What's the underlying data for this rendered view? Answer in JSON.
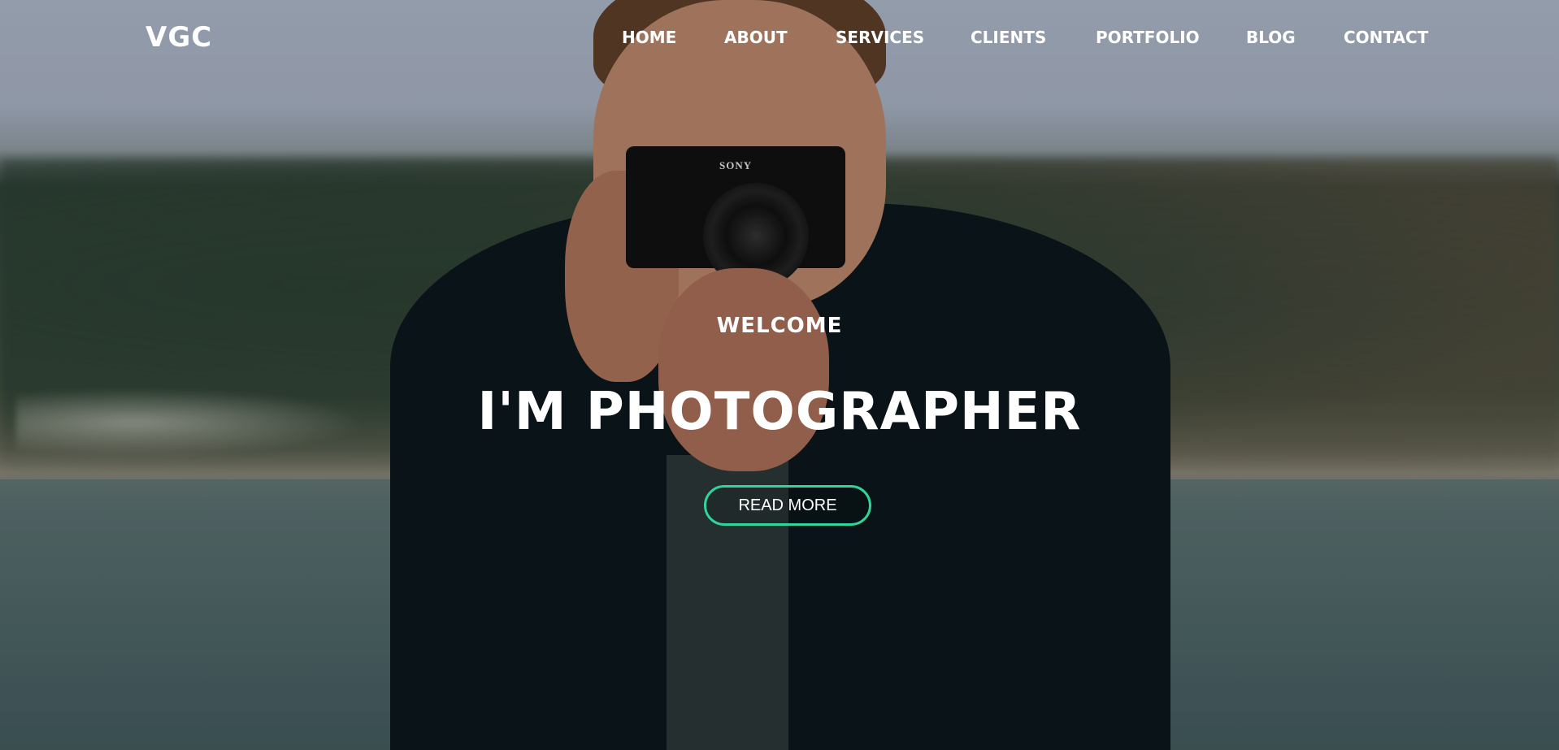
{
  "site": {
    "logo": "VGC"
  },
  "nav": {
    "items": [
      {
        "label": "HOME"
      },
      {
        "label": "ABOUT"
      },
      {
        "label": "SERVICES"
      },
      {
        "label": "CLIENTS"
      },
      {
        "label": "PORTFOLIO"
      },
      {
        "label": "BLOG"
      },
      {
        "label": "CONTACT"
      }
    ]
  },
  "hero": {
    "welcome": "WELCOME",
    "headline": "I'M PHOTOGRAPHER",
    "cta_label": "READ MORE",
    "camera_brand": "SONY"
  },
  "colors": {
    "accent": "#2ed69b",
    "text": "#ffffff"
  }
}
